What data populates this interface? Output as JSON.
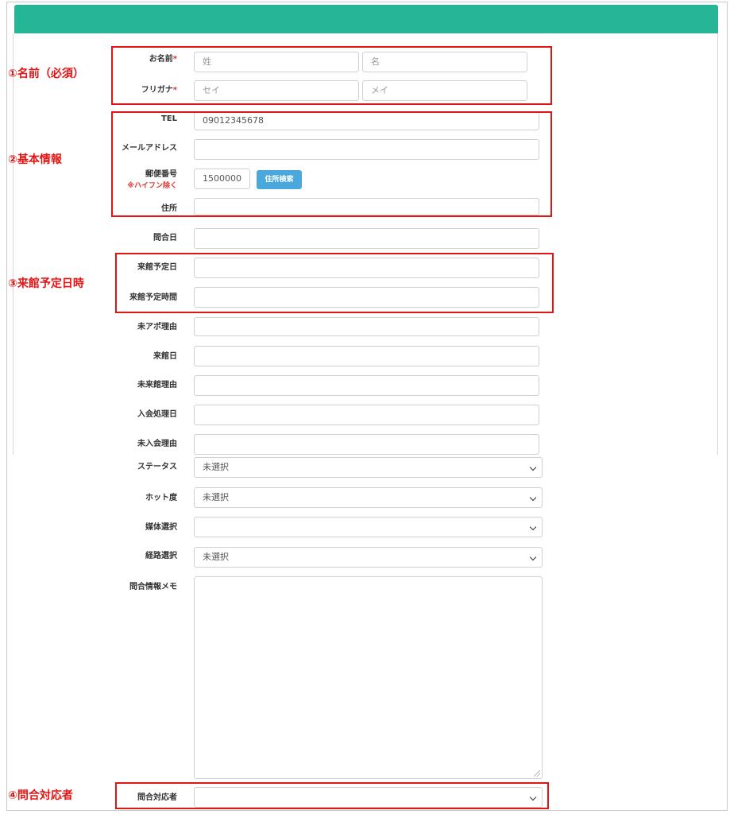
{
  "annotations": {
    "name": "①名前（必須）",
    "basic": "②基本情報",
    "visit": "③来館予定日時",
    "handler": "④問合対応者"
  },
  "form": {
    "name": {
      "label": "お名前",
      "req": "*",
      "last_placeholder": "姓",
      "first_placeholder": "名"
    },
    "kana": {
      "label": "フリガナ",
      "req": "*",
      "last_placeholder": "セイ",
      "first_placeholder": "メイ"
    },
    "tel": {
      "label": "TEL",
      "value": "09012345678"
    },
    "email": {
      "label": "メールアドレス",
      "value": ""
    },
    "zip": {
      "label": "郵便番号",
      "note": "※ハイフン除く",
      "value": "1500000",
      "button": "住所検索"
    },
    "address": {
      "label": "住所",
      "value": ""
    },
    "inquiry_date": {
      "label": "問合日",
      "value": ""
    },
    "visit_date": {
      "label": "来館予定日",
      "value": ""
    },
    "visit_time": {
      "label": "来館予定時間",
      "value": ""
    },
    "no_appt_reason": {
      "label": "未アポ理由",
      "value": ""
    },
    "visited_date": {
      "label": "来館日",
      "value": ""
    },
    "no_visit_reason": {
      "label": "未来館理由",
      "value": ""
    },
    "join_date": {
      "label": "入会処理日",
      "value": ""
    },
    "no_join_reason": {
      "label": "未入会理由",
      "value": ""
    },
    "status": {
      "label": "ステータス",
      "value": "未選択"
    },
    "hotness": {
      "label": "ホット度",
      "value": "未選択"
    },
    "media": {
      "label": "媒体選択",
      "value": ""
    },
    "route": {
      "label": "経路選択",
      "value": "未選択"
    },
    "memo": {
      "label": "問合情報メモ",
      "value": ""
    },
    "handler": {
      "label": "問合対応者",
      "value": ""
    }
  },
  "colors": {
    "header": "#26b597",
    "annotation": "#e31414",
    "button": "#4aa8dc"
  }
}
